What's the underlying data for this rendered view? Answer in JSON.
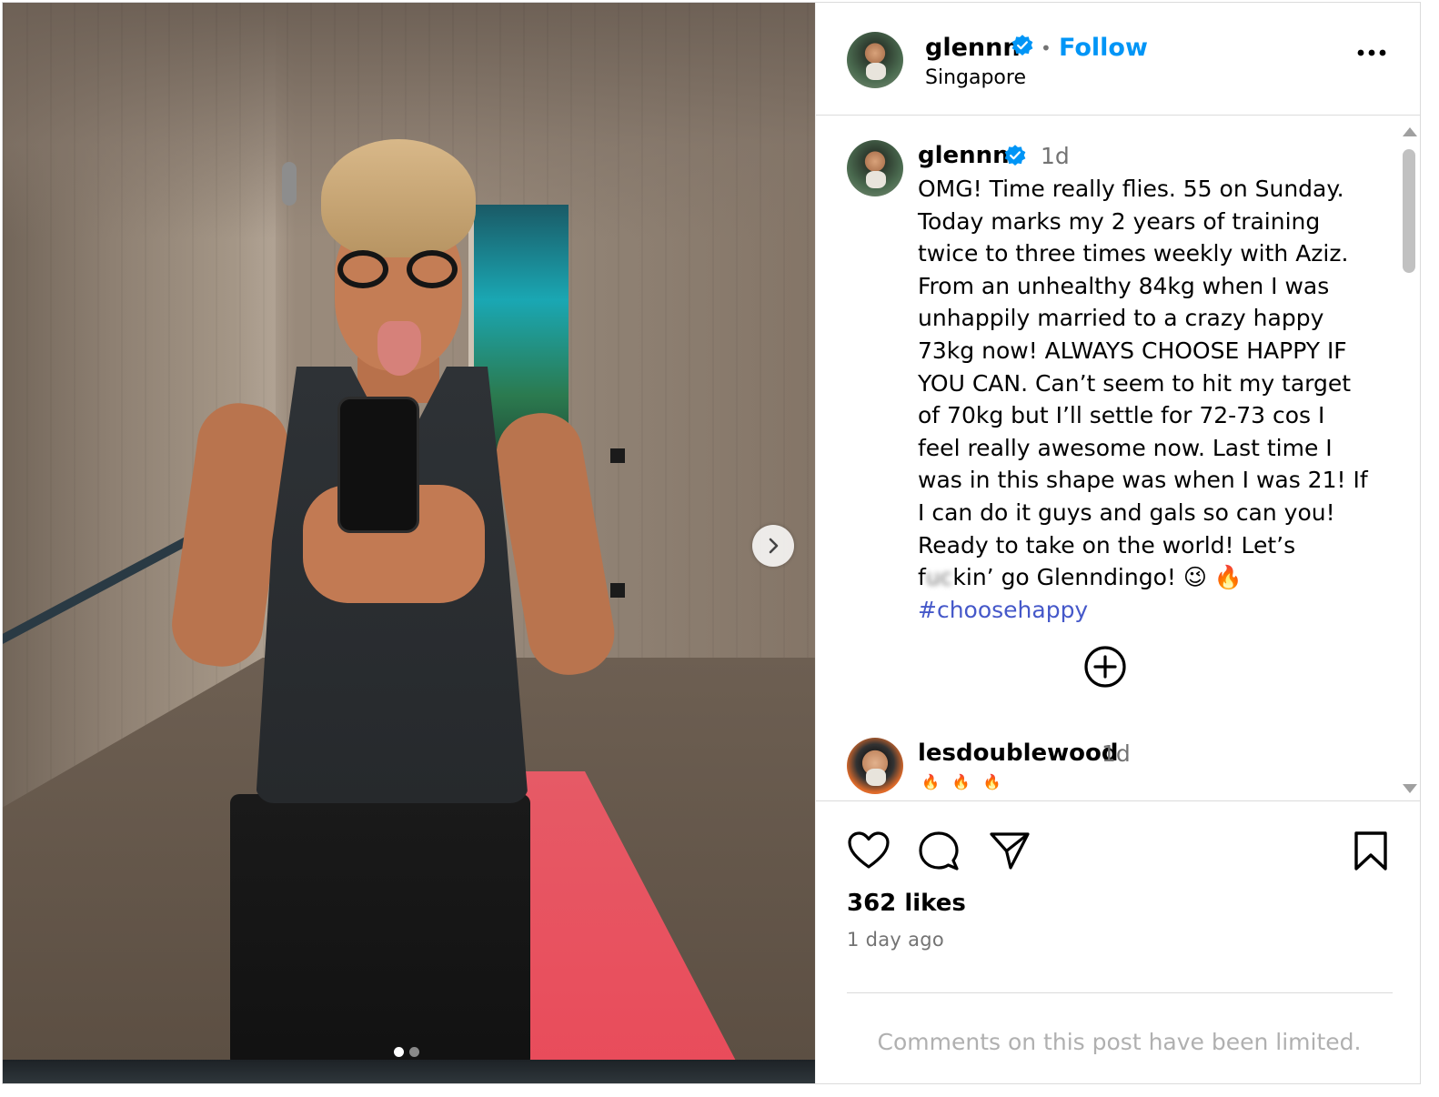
{
  "post": {
    "carousel": {
      "total_slides": 2,
      "active_slide": 1
    }
  },
  "header": {
    "username": "glennn",
    "separator": "•",
    "follow_label": "Follow",
    "location": "Singapore"
  },
  "caption": {
    "username": "glennn",
    "time": "1d",
    "text_before_censor": "OMG! Time really flies. 55 on Sunday. Today marks my 2 years of training twice to three times weekly with Aziz. From an unhealthy 84kg when I was unhappily married to a crazy happy 73kg now! ALWAYS CHOOSE HAPPY IF YOU CAN. Can’t seem to hit my target of 70kg but I’ll settle for 72-73 cos I feel really awesome now. Last time I was in this shape was when I was 21! If I can do it guys and gals so can you! Ready to take on the world! Let’s f",
    "censored": "uc",
    "text_after_censor": "kin’ go Glenndingo! ",
    "emoji_1": "😉",
    "emoji_2": "🔥",
    "hashtag": "#choosehappy"
  },
  "comments": [
    {
      "username": "lesdoublewood",
      "time": "1d",
      "flames": [
        "🔥",
        "🔥",
        "🔥"
      ]
    }
  ],
  "actions": {
    "likes": "362 likes",
    "posted_ago": "1 day ago",
    "limited_notice": "Comments on this post have been limited."
  },
  "colors": {
    "accent": "#0095f6",
    "hashtag": "#4558c9",
    "muted": "#737373",
    "border": "#dbdbdb"
  },
  "icons": {
    "verified": "verified-badge-icon",
    "more": "more-options-icon",
    "load_more": "plus-circle-icon",
    "like": "heart-icon",
    "comment": "comment-bubble-icon",
    "share": "paper-plane-icon",
    "save": "bookmark-icon",
    "next": "chevron-right-icon"
  }
}
